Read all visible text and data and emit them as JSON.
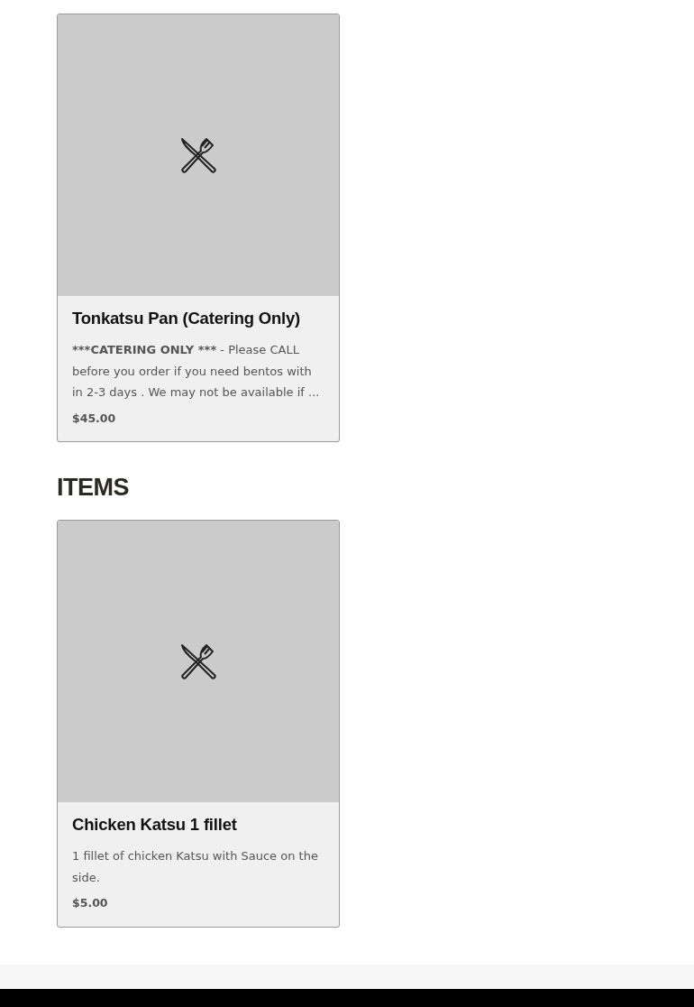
{
  "sections": [
    {
      "items": [
        {
          "name": "Tonkatsu Pan (Catering Only)",
          "description_lead": "***CATERING ONLY ***",
          "description": " - Please CALL before you order if you need bentos with in 2-3 days . We may not be available if ...",
          "price": "$45.00"
        }
      ]
    },
    {
      "heading": "ITEMS",
      "items": [
        {
          "name": "Chicken Katsu 1 fillet",
          "description": "1 fillet of chicken Katsu with Sauce on the side.",
          "price": "$5.00"
        }
      ]
    }
  ]
}
